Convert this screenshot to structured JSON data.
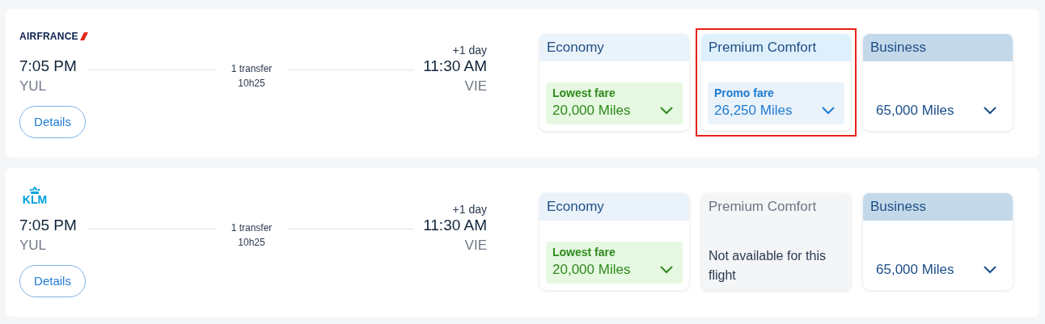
{
  "flights": [
    {
      "airline": {
        "kind": "airfrance",
        "name": "AIRFRANCE"
      },
      "departure": {
        "time": "7:05 PM",
        "airport": "YUL"
      },
      "transfer": "1 transfer",
      "duration": "10h25",
      "arrival": {
        "day_offset": "+1 day",
        "time": "11:30 AM",
        "airport": "VIE"
      },
      "details_button": "Details",
      "cabins": [
        {
          "name": "Economy",
          "color": "#eaf2fa",
          "kind": "lowest",
          "tag": "Lowest fare",
          "price": "20,000 Miles",
          "highlighted": false
        },
        {
          "name": "Premium Comfort",
          "color": "#def0fc",
          "kind": "promo",
          "tag": "Promo fare",
          "price": "26,250 Miles",
          "highlighted": true
        },
        {
          "name": "Business",
          "color": "#c3d9ea",
          "kind": "standard",
          "price": "65,000 Miles",
          "highlighted": false
        }
      ]
    },
    {
      "airline": {
        "kind": "klm",
        "name": "KLM"
      },
      "departure": {
        "time": "7:05 PM",
        "airport": "YUL"
      },
      "transfer": "1 transfer",
      "duration": "10h25",
      "arrival": {
        "day_offset": "+1 day",
        "time": "11:30 AM",
        "airport": "VIE"
      },
      "details_button": "Details",
      "cabins": [
        {
          "name": "Economy",
          "color": "#eaf2fa",
          "kind": "lowest",
          "tag": "Lowest fare",
          "price": "20,000 Miles",
          "highlighted": false
        },
        {
          "name": "Premium Comfort",
          "color": "#f4f5f7",
          "kind": "unavailable",
          "message": "Not available for this flight",
          "highlighted": false
        },
        {
          "name": "Business",
          "color": "#c3d9ea",
          "kind": "standard",
          "price": "65,000 Miles",
          "highlighted": false
        }
      ]
    }
  ]
}
